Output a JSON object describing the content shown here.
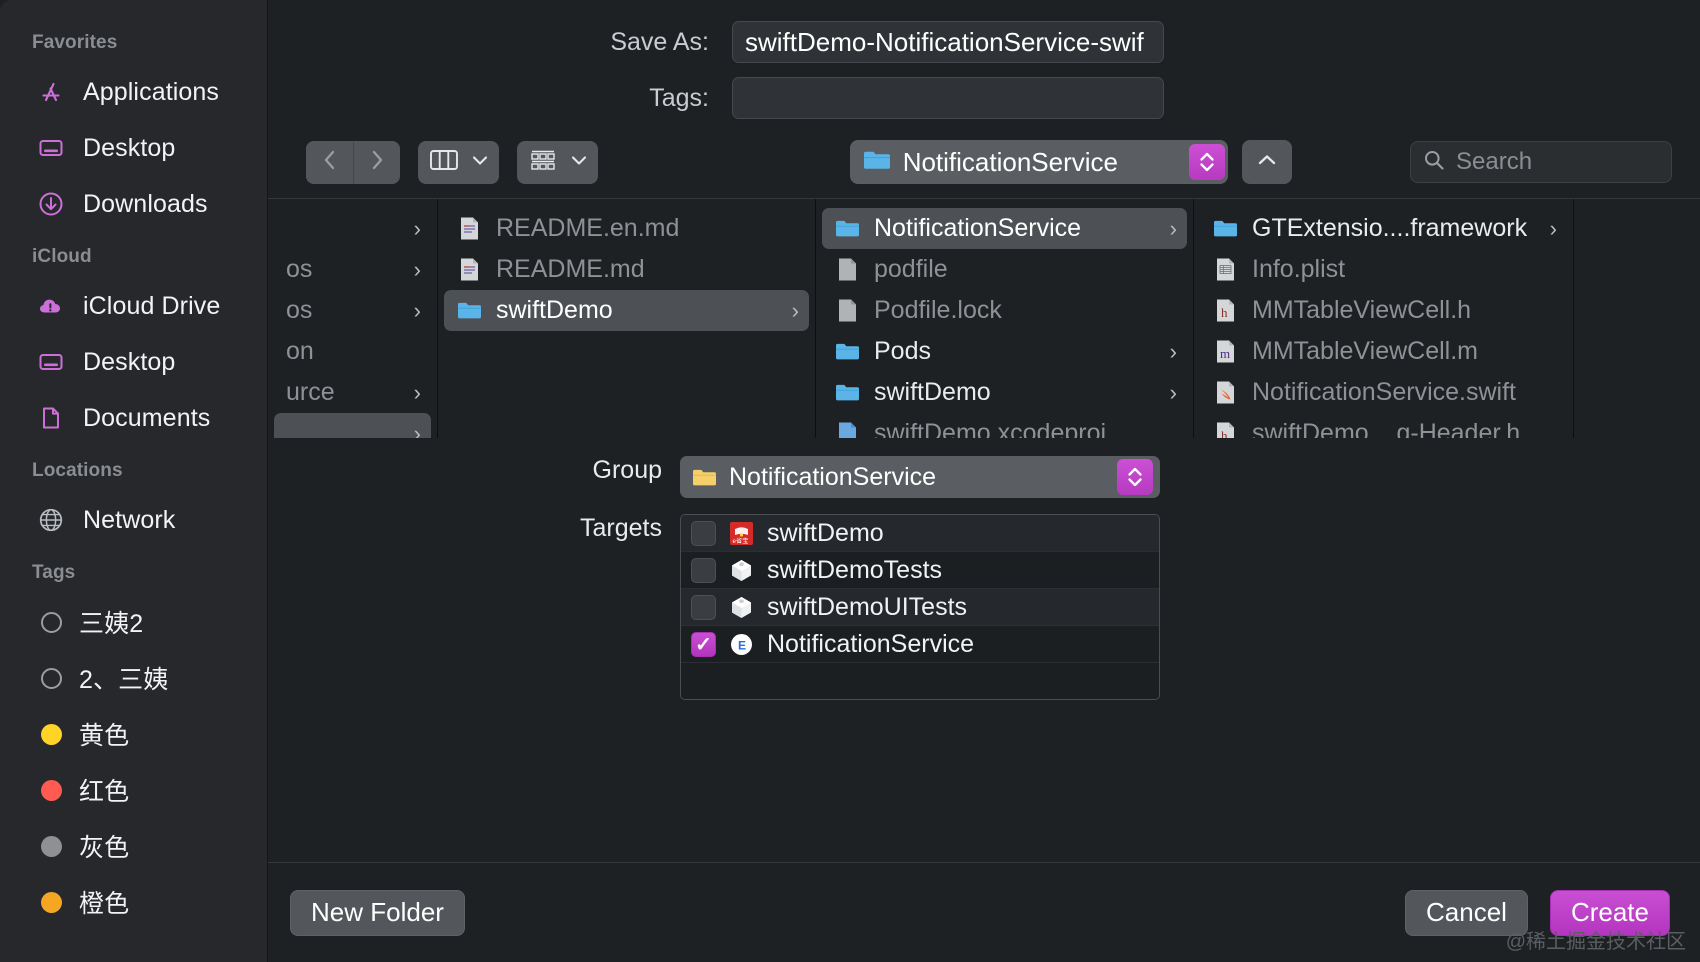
{
  "sidebar": {
    "sections": [
      {
        "title": "Favorites",
        "items": [
          {
            "label": "Applications",
            "icon": "applications-icon"
          },
          {
            "label": "Desktop",
            "icon": "desktop-icon"
          },
          {
            "label": "Downloads",
            "icon": "downloads-icon"
          }
        ]
      },
      {
        "title": "iCloud",
        "items": [
          {
            "label": "iCloud Drive",
            "icon": "icloud-drive-icon"
          },
          {
            "label": "Desktop",
            "icon": "desktop-icon"
          },
          {
            "label": "Documents",
            "icon": "documents-icon"
          }
        ]
      },
      {
        "title": "Locations",
        "items": [
          {
            "label": "Network",
            "icon": "network-globe-icon"
          }
        ]
      },
      {
        "title": "Tags",
        "items": [
          {
            "label": "三姨2",
            "icon": "tag-dot-icon",
            "color": "none"
          },
          {
            "label": "2、三姨",
            "icon": "tag-dot-icon",
            "color": "none"
          },
          {
            "label": "黄色",
            "icon": "tag-dot-icon",
            "color": "#ffd426"
          },
          {
            "label": "红色",
            "icon": "tag-dot-icon",
            "color": "#ff5b52"
          },
          {
            "label": "灰色",
            "icon": "tag-dot-icon",
            "color": "#8e9094"
          },
          {
            "label": "橙色",
            "icon": "tag-dot-icon",
            "color": "#f5a623"
          }
        ]
      }
    ]
  },
  "form": {
    "save_as_label": "Save As:",
    "save_as_value": "swiftDemo-NotificationService-swif",
    "tags_label": "Tags:",
    "tags_value": "",
    "tags_placeholder": ""
  },
  "toolbar": {
    "back_icon": "chevron-left-icon",
    "forward_icon": "chevron-right-icon",
    "view_icon": "column-view-icon",
    "view_chevron": "chevron-down-icon",
    "group_icon": "group-by-icon",
    "group_chevron": "chevron-down-icon",
    "path_label": "NotificationService",
    "path_icon": "blue-folder-icon",
    "path_stepper_icon": "stepper-up-down-icon",
    "up_icon": "chevron-up-icon",
    "search_icon": "search-icon",
    "search_placeholder": "Search",
    "search_value": ""
  },
  "browser": {
    "columns": [
      {
        "items": [
          {
            "name": "",
            "type": "blank",
            "chevron": true,
            "selected": false,
            "dim": true
          },
          {
            "name": "os",
            "type": "folder-text",
            "chevron": true,
            "selected": false,
            "dim": true
          },
          {
            "name": "os",
            "type": "folder-text",
            "chevron": true,
            "selected": false,
            "dim": true
          },
          {
            "name": "on",
            "type": "folder-text",
            "chevron": false,
            "selected": false,
            "dim": true
          },
          {
            "name": "urce",
            "type": "folder-text",
            "chevron": true,
            "selected": false,
            "dim": true
          },
          {
            "name": "",
            "type": "blank",
            "chevron": true,
            "selected": true,
            "dim": false
          }
        ]
      },
      {
        "items": [
          {
            "name": "README.en.md",
            "type": "md-file",
            "chevron": false,
            "selected": false,
            "dim": true
          },
          {
            "name": "README.md",
            "type": "md-file",
            "chevron": false,
            "selected": false,
            "dim": true
          },
          {
            "name": "swiftDemo",
            "type": "folder",
            "chevron": true,
            "selected": true,
            "dim": false
          }
        ]
      },
      {
        "items": [
          {
            "name": "NotificationService",
            "type": "folder",
            "chevron": true,
            "selected": true,
            "dim": false
          },
          {
            "name": "podfile",
            "type": "plain-file",
            "chevron": false,
            "selected": false,
            "dim": true
          },
          {
            "name": "Podfile.lock",
            "type": "plain-file",
            "chevron": false,
            "selected": false,
            "dim": true
          },
          {
            "name": "Pods",
            "type": "folder",
            "chevron": true,
            "selected": false,
            "dim": false
          },
          {
            "name": "swiftDemo",
            "type": "folder",
            "chevron": true,
            "selected": false,
            "dim": false
          },
          {
            "name": "swiftDemo.xcodeproj",
            "type": "xcode-file",
            "chevron": false,
            "selected": false,
            "dim": true
          }
        ]
      },
      {
        "items": [
          {
            "name": "GTExtensio....framework",
            "type": "folder",
            "chevron": true,
            "selected": false,
            "dim": false
          },
          {
            "name": "Info.plist",
            "type": "plist-file",
            "chevron": false,
            "selected": false,
            "dim": true
          },
          {
            "name": "MMTableViewCell.h",
            "type": "h-file",
            "chevron": false,
            "selected": false,
            "dim": true
          },
          {
            "name": "MMTableViewCell.m",
            "type": "m-file",
            "chevron": false,
            "selected": false,
            "dim": true
          },
          {
            "name": "NotificationService.swift",
            "type": "swift-file",
            "chevron": false,
            "selected": false,
            "dim": true
          },
          {
            "name": "swiftDemo....g-Header.h",
            "type": "h-file",
            "chevron": false,
            "selected": false,
            "dim": true
          }
        ]
      }
    ]
  },
  "accessory": {
    "group_label": "Group",
    "group_value": "NotificationService",
    "group_icon": "yellow-folder-icon",
    "group_stepper_icon": "stepper-up-down-icon",
    "targets_label": "Targets",
    "targets": [
      {
        "name": "swiftDemo",
        "checked": false,
        "icon": "app-icon"
      },
      {
        "name": "swiftDemoTests",
        "checked": false,
        "icon": "test-bundle-icon"
      },
      {
        "name": "swiftDemoUITests",
        "checked": false,
        "icon": "test-bundle-icon"
      },
      {
        "name": "NotificationService",
        "checked": true,
        "icon": "extension-icon"
      }
    ]
  },
  "footer": {
    "new_folder_label": "New Folder",
    "cancel_label": "Cancel",
    "create_label": "Create",
    "watermark": "@稀土掘金技术社区"
  },
  "colors": {
    "accent": "#bf3fc9",
    "sidebar_icon": "#cc6fd8",
    "folder_blue": "#5ab4e8",
    "folder_yellow": "#f5d06a"
  }
}
